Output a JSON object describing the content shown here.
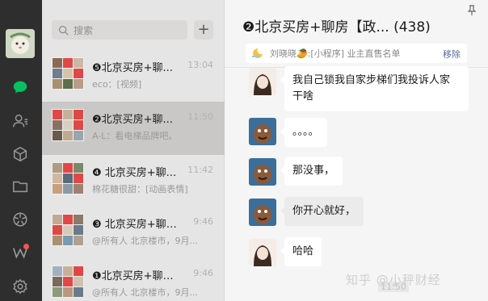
{
  "sidebar": {
    "icons": [
      "avatar",
      "chat-icon",
      "contacts-icon",
      "box-icon",
      "folder-icon",
      "moments-icon",
      "channels-icon",
      "settings-icon"
    ],
    "active_color": "#07c160",
    "badge_color": "#fa5151"
  },
  "search": {
    "placeholder": "搜索"
  },
  "add_label": "+",
  "conversations": [
    {
      "title": "❺北京买房+聊...",
      "time": "13:04",
      "preview": "eco：[视频]"
    },
    {
      "title": "❷北京买房+聊...",
      "time": "11:50",
      "preview": "A-L：看电梯品牌吧。"
    },
    {
      "title": "❹ 北京买房+聊...",
      "time": "11:42",
      "preview": "棉花糖很甜：[动画表情]"
    },
    {
      "title": "❸ 北京买房+聊房...",
      "time": "9:46",
      "preview": "@所有人 北京楼市，9月..."
    },
    {
      "title": "❶北京买房+聊房...",
      "time": "9:46",
      "preview": "@所有人 北京楼市，9月..."
    }
  ],
  "chat": {
    "title": "❷北京买房+聊房【政...  (438)",
    "pinned_text": "刘晓晓🥭:[小程序] 业主直售名单",
    "pinned_remove": "移除",
    "messages": [
      {
        "text": "我自己锁我自家步梯们我投诉人家干啥",
        "line1": "我自己锁我自家步梯们我投诉人家",
        "line2": "干啥"
      },
      {
        "text": "。。。。"
      },
      {
        "text": "那没事，"
      },
      {
        "text": "你开心就好，"
      },
      {
        "text": "哈哈"
      }
    ],
    "timestamp": "11:50"
  },
  "watermark": "知乎 @小秤财经"
}
